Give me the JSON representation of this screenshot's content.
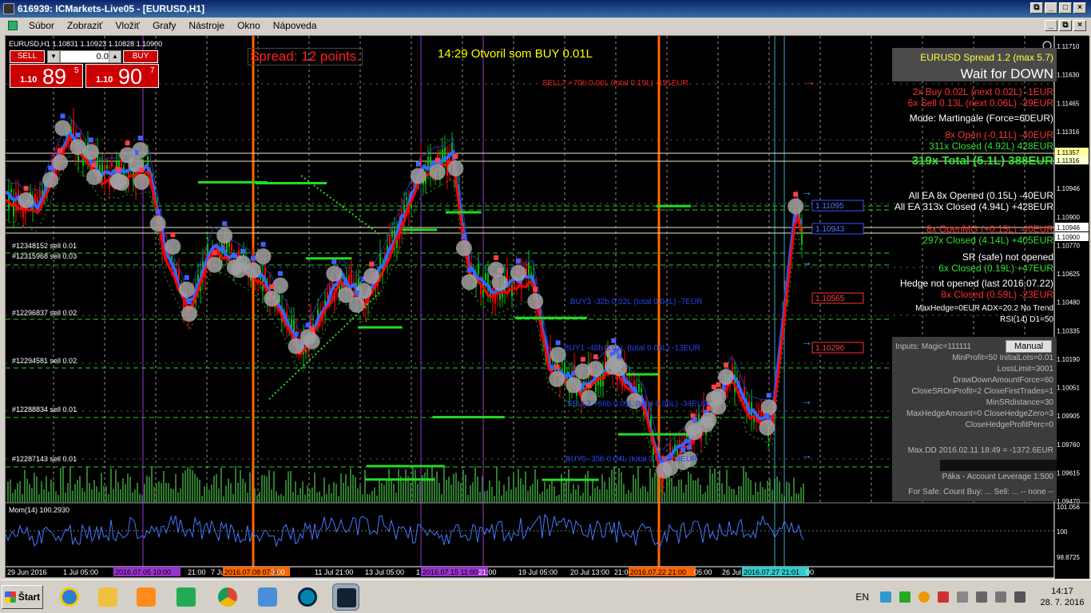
{
  "window": {
    "title": "616939: ICMarkets-Live05 - [EURUSD,H1]"
  },
  "menu": [
    "Súbor",
    "Zobraziť",
    "Vložiť",
    "Grafy",
    "Nástroje",
    "Okno",
    "Nápoveda"
  ],
  "chart_header": "EURUSD,H1  1.10831 1.10923 1.10828 1.10900",
  "trade": {
    "sell_label": "SELL",
    "buy_label": "BUY",
    "lot": "0.01",
    "sell_pre": "1.10",
    "sell_big": "89",
    "sell_sup": "5",
    "buy_pre": "1.10",
    "buy_big": "90",
    "buy_sup": "7"
  },
  "overlay": {
    "spread": "Spread: 12 points.",
    "opened": "14:29 Otvoril som BUY 0.01L",
    "sell7": "SELL7  +70b  0.06L (total 0.19L)  -151EUR",
    "buy13": "BUY3  -32b  0.02L (total 0.04L)  -7EUR",
    "buy_mid": "BUY1  -48b  0.01L (total 0.06L)  -13EUR",
    "sell_mid": "SELL2  +66b  0.03L (total 0.06L)  -34EUR",
    "buy_low": "BUY5  -35b  0.04L (total 0.06L)  -8EUR"
  },
  "left_labels": [
    "#12348152 sell 0.01",
    "#12315968 sell 0.03",
    "#12296837 sell 0.02",
    "#12294581 sell 0.02",
    "#12288834 sell 0.01",
    "#12287143 sell 0.01"
  ],
  "order_tags": [
    "1.11095",
    "1.10943",
    "1.10565",
    "1.10296"
  ],
  "info": {
    "spread_line": "EURUSD Spread 1.2 (max 5.7)",
    "status": "Wait for DOWN",
    "buy_line": "2x Buy 0.02L (next 0.02L) -1EUR",
    "sell_line": "6x Sell 0.13L (next 0.06L) -39EUR",
    "mode": "Mode: Martingale (Force=60EUR)",
    "open_line": "8x Open (-0.11L) -40EUR",
    "closed_line": "311x Closed (4.92L) 428EUR",
    "total": "319x Total (5.1L) 388EUR",
    "all_opened": "All EA 8x Opened (0.15L) -40EUR",
    "all_closed": "All EA 313x Closed (4.94L) +428EUR",
    "openmg": "8x OpenMG (+0.15L) -40EUR",
    "closed297": "297x Closed (4.14L) +405EUR",
    "sr_line": "SR (safe) not opened",
    "closed6": "6x Closed (0.19L) +47EUR",
    "hedge_line": "Hedge not opened (last 2016.07.22)",
    "closed8": "8x Closed (0.59L) -23EUR",
    "maxhedge": "MaxHedge=0EUR  ADX=20.2  No Trend",
    "rsi": "RSI(14) D1=50",
    "manual": "Manual",
    "inputs": [
      "Inputs: Magic=111111",
      "MinProfit=50   InitialLots=0.01",
      "LossLimit=3001",
      "DrawDownAmountForce=60",
      "CloseSROnProfit=2  CloseFirstTrades=1",
      "MinSRdistance=30",
      "MaxHedgeAmount=0  CloseHedgeZero=3",
      "CloseHedgeProfitPerc=0"
    ],
    "maxdd": "Max.DD  2016.02.11 18:49 = -1372.6EUR",
    "leverage": "Páka - Account Leverage 1:500",
    "forsafe": "For Safe: Count Buy: ...  Sell: ... -- none --"
  },
  "price_axis": [
    "1.11710",
    "1.11630",
    "1.11465",
    "1.11316",
    "1.11105",
    "1.10946",
    "1.10900",
    "1.10770",
    "1.10625",
    "1.10480",
    "1.10335",
    "1.10190",
    "1.10051",
    "1.09905",
    "1.09760",
    "1.09615",
    "1.09470"
  ],
  "price_tags": {
    "upper": "1.11357",
    "mid": "1.11316",
    "bid": "1.10946",
    "ask": "1.10900"
  },
  "mom": {
    "label": "Mom(14) 100.2930",
    "axis": [
      "101.056",
      "100",
      "98.8725"
    ]
  },
  "time_axis": [
    "29 Jun 2016",
    "1 Jul 05:00",
    "2016.07.05 10:00",
    "21:00",
    "7 Jul",
    "2016.07.08 07:00",
    "3:00",
    "11 Jul 21:00",
    "13 Jul 05:00",
    "1",
    "2016.07.15 11:00",
    "21:00",
    "19 Jul 05:00",
    "20 Jul 13:00",
    "21:00",
    "2016.07.22 21:00",
    "05:00",
    "26 Jul",
    "2016.07.27 21:01",
    "00"
  ],
  "taskbar": {
    "start": "Štart",
    "lang": "EN",
    "time": "14:17",
    "date": "28. 7. 2016"
  },
  "colors": {
    "bull": "#00c000",
    "bear": "#ff0000",
    "ma": "#3366ff",
    "info_red": "#ff3030",
    "info_green": "#30e030",
    "orange_line": "#ff6600",
    "violet_line": "#9933cc"
  }
}
